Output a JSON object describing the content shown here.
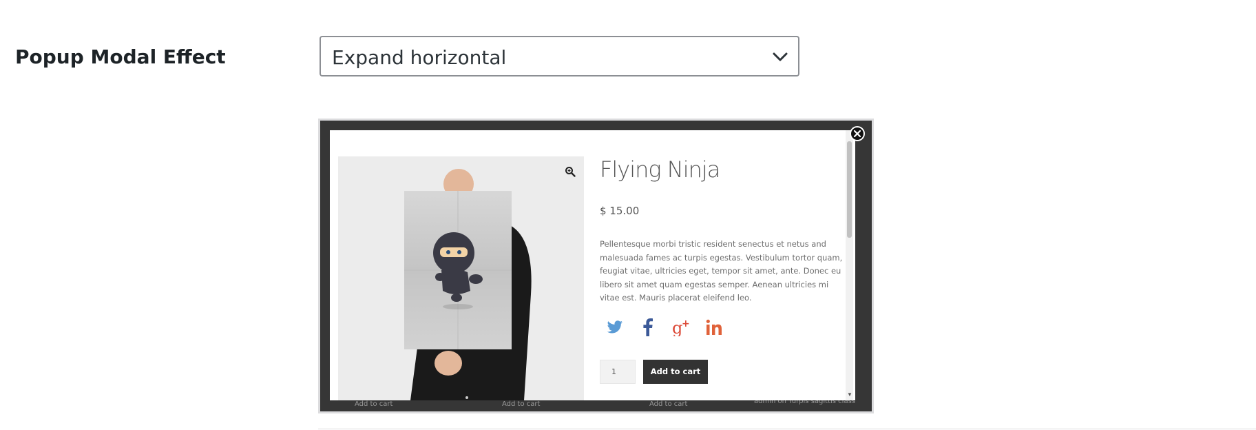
{
  "setting": {
    "label": "Popup Modal Effect",
    "selected_value": "Expand horizontal"
  },
  "preview": {
    "background_texts": [
      "Add to cart",
      "Add to cart",
      "Add to cart",
      "admin on Turpis sagittis class"
    ],
    "product": {
      "title": "Flying Ninja",
      "price": "$ 15.00",
      "description": "Pellentesque morbi tristic resident senectus et netus and malesuada fames ac turpis egestas. Vestibulum tortor quam, feugiat vitae, ultricies eget, tempor sit amet, ante. Donec eu libero sit amet quam egestas semper. Aenean ultricies mi vitae est. Mauris placerat eleifend leo.",
      "quantity": "1",
      "add_to_cart_label": "Add to cart"
    },
    "social_icons": [
      "twitter-icon",
      "facebook-icon",
      "google-plus-icon",
      "linkedin-icon"
    ],
    "colors": {
      "twitter": "#5a9bd5",
      "facebook": "#3b5998",
      "google_plus": "#dc4a38",
      "linkedin": "#e0623a",
      "button": "#333333"
    }
  }
}
